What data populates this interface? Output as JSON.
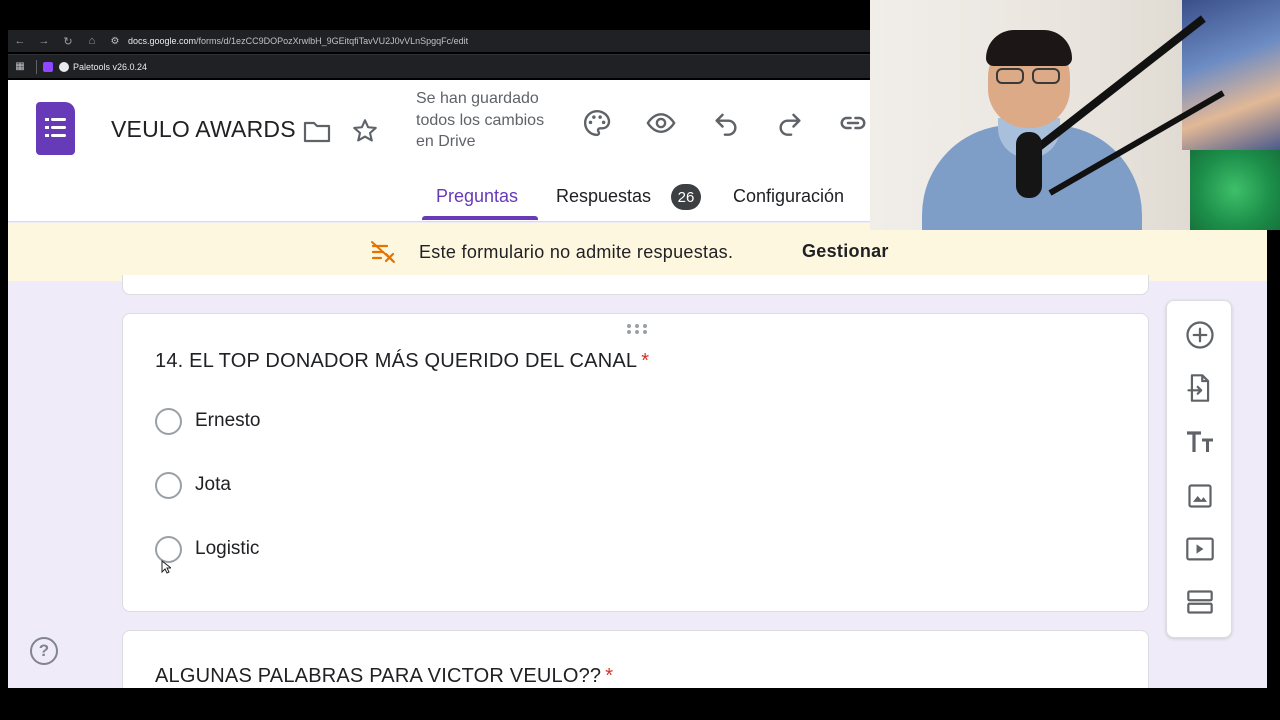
{
  "browser": {
    "url_host": "docs.google.com",
    "url_path": "/forms/d/1ezCC9DOPozXrwlbH_9GEitqfiTavVU2J0vVLnSpgqFc/edit",
    "bookmark": "Paletools v26.0.24"
  },
  "header": {
    "title": "VEULO AWARDS",
    "saved_status": "Se han guardado todos los cambios en Drive",
    "tabs": [
      {
        "label": "Preguntas"
      },
      {
        "label": "Respuestas",
        "badge": "26"
      },
      {
        "label": "Configuración"
      }
    ]
  },
  "banner": {
    "message": "Este formulario no admite respuestas.",
    "action": "Gestionar"
  },
  "question": {
    "title": "14. EL TOP DONADOR MÁS QUERIDO DEL CANAL",
    "required_marker": "*",
    "options": [
      "Ernesto",
      "Jota",
      "Logistic"
    ]
  },
  "next_question": {
    "title": "ALGUNAS PALABRAS PARA VICTOR VEULO??",
    "required_marker": "*"
  },
  "help": {
    "label": "?"
  },
  "colors": {
    "accent": "#673ab7",
    "page_bg": "#f0ebf8",
    "banner_bg": "#fef7e0",
    "required": "#d93025"
  }
}
